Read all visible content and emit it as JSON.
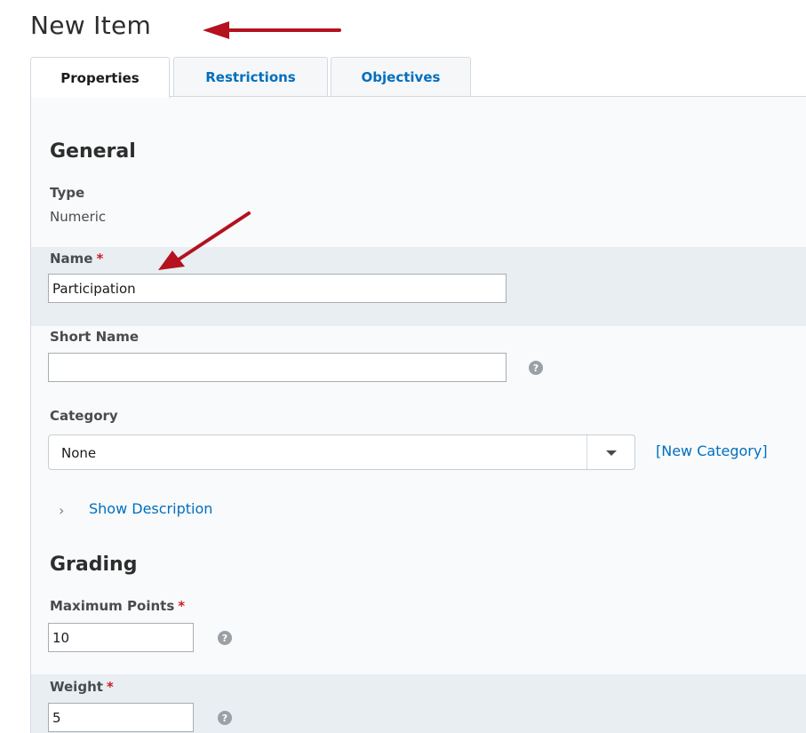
{
  "page": {
    "title": "New Item"
  },
  "tabs": [
    {
      "label": "Properties",
      "active": true
    },
    {
      "label": "Restrictions",
      "active": false
    },
    {
      "label": "Objectives",
      "active": false
    }
  ],
  "general": {
    "heading": "General",
    "type_label": "Type",
    "type_value": "Numeric",
    "name_label": "Name",
    "name_value": "Participation",
    "required_mark": "*",
    "short_name_label": "Short Name",
    "short_name_value": "",
    "category_label": "Category",
    "category_value": "None",
    "new_category_link": "[New Category]",
    "show_description_link": "Show Description"
  },
  "grading": {
    "heading": "Grading",
    "max_points_label": "Maximum Points",
    "max_points_value": "10",
    "weight_label": "Weight",
    "weight_value": "5"
  },
  "icons": {
    "help": "question-circle-icon",
    "dropdown": "chevron-down-icon",
    "expand": "chevron-right-icon",
    "annotation": "red-arrow-icon"
  },
  "colors": {
    "accent": "#006fbf",
    "required": "#cd2026",
    "band": "#e8eef2",
    "arrow": "#b3121e"
  }
}
